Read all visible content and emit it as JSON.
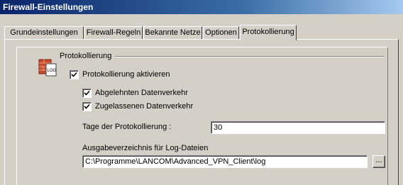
{
  "window": {
    "title": "Firewall-Einstellungen"
  },
  "tabs": [
    {
      "label": "Grundeinstellungen"
    },
    {
      "label": "Firewall-Regeln"
    },
    {
      "label": "Bekannte Netze"
    },
    {
      "label": "Optionen"
    },
    {
      "label": "Protokollierung",
      "active": true
    }
  ],
  "protokollierung": {
    "group_label": "Protokollierung",
    "icon": "log-file-icon",
    "enable": {
      "label": "Protokollierung aktivieren",
      "checked": true
    },
    "rejected": {
      "label": "Abgelehnten Datenverkehr",
      "checked": true
    },
    "allowed": {
      "label": "Zugelassenen Datenverkehr",
      "checked": true
    },
    "days": {
      "label": "Tage der Protokollierung :",
      "value": "30"
    },
    "outdir": {
      "label": "Ausgabeverzeichnis für Log-Dateien",
      "value": "C:\\Programme\\LANCOM\\Advanced_VPN_Client\\log",
      "browse_label": "..."
    }
  }
}
